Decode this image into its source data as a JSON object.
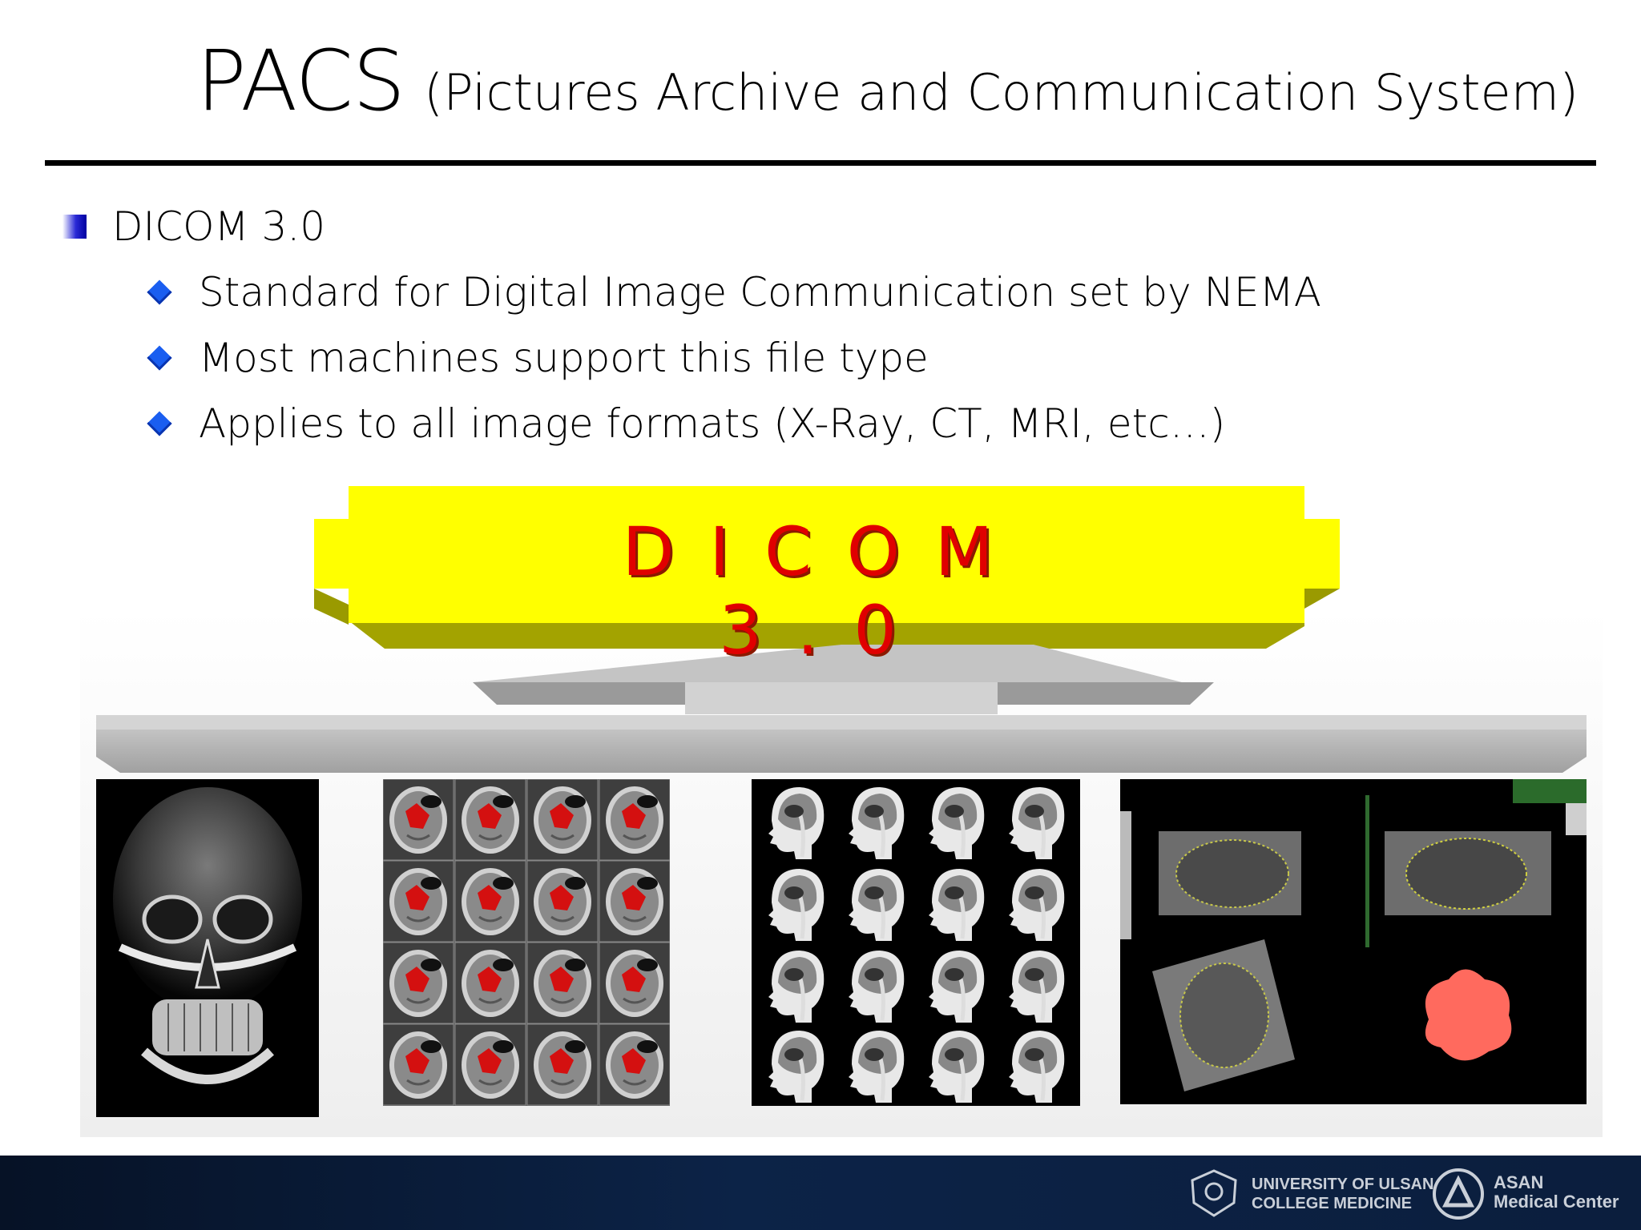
{
  "title": {
    "main": "PACS",
    "subtitle": "(Pictures Archive and Communication System)"
  },
  "bullets": {
    "level1": "DICOM 3.0",
    "level2": [
      "Standard for Digital Image Communication set by NEMA",
      "Most machines support this file type",
      "Applies to all image formats (X-Ray, CT, MRI, etc…)"
    ]
  },
  "diagram": {
    "banner_label": "DICOM 3.0",
    "banner_color": "#ffff00",
    "connector_color": "#a8a8a8"
  },
  "images": [
    {
      "kind": "skull-xray"
    },
    {
      "kind": "mri-axial-grid"
    },
    {
      "kind": "mri-sagittal-grid"
    },
    {
      "kind": "ultrasound-3d"
    }
  ],
  "footer": {
    "university": [
      "UNIVERSITY OF ULSAN",
      "COLLEGE MEDICINE"
    ],
    "hospital": [
      "ASAN",
      "Medical Center"
    ]
  }
}
